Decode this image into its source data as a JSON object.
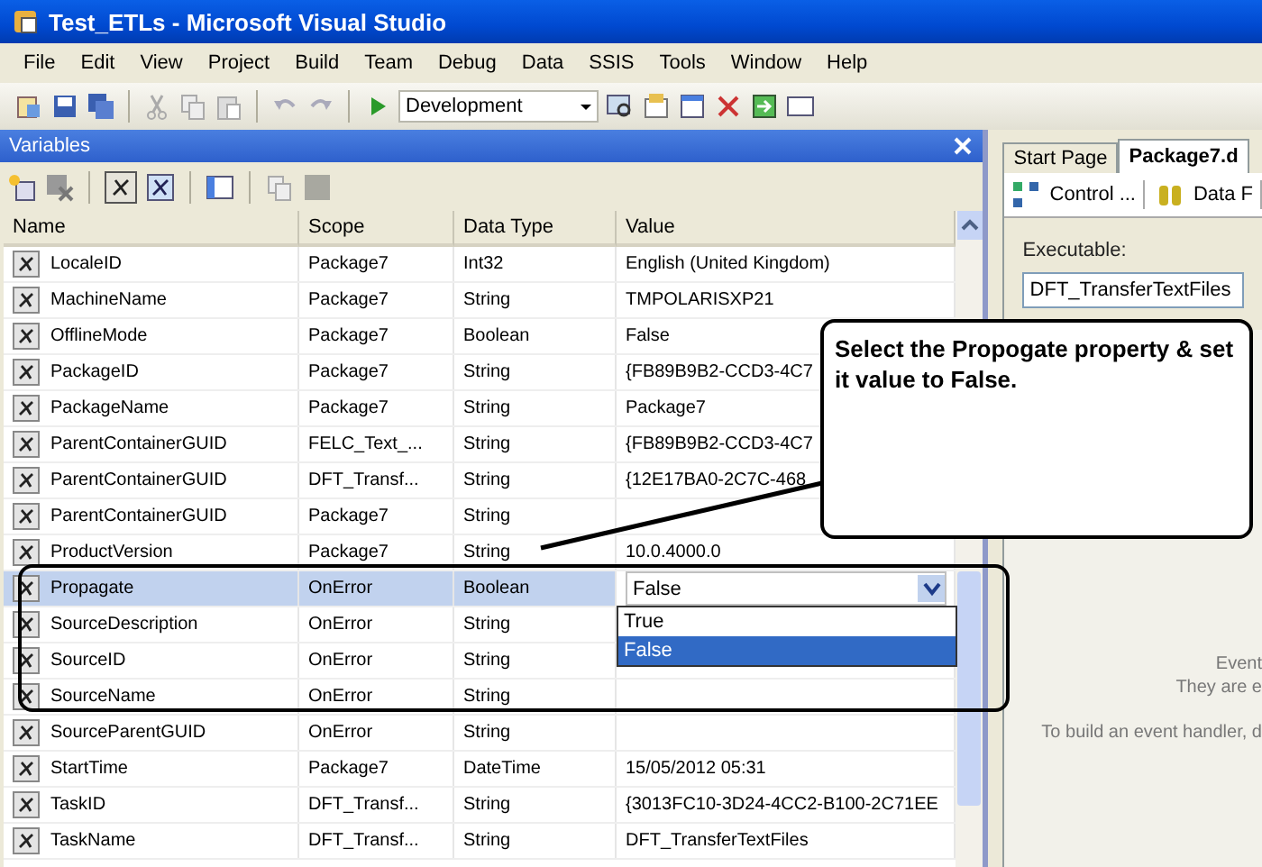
{
  "window": {
    "title": "Test_ETLs - Microsoft Visual Studio"
  },
  "menu": [
    "File",
    "Edit",
    "View",
    "Project",
    "Build",
    "Team",
    "Debug",
    "Data",
    "SSIS",
    "Tools",
    "Window",
    "Help"
  ],
  "toolbar": {
    "configuration": "Development"
  },
  "variables": {
    "title": "Variables",
    "columns": [
      "Name",
      "Scope",
      "Data Type",
      "Value"
    ],
    "rows": [
      {
        "name": "LocaleID",
        "scope": "Package7",
        "type": "Int32",
        "value": "English (United Kingdom)",
        "selected": false
      },
      {
        "name": "MachineName",
        "scope": "Package7",
        "type": "String",
        "value": "TMPOLARISXP21",
        "selected": false
      },
      {
        "name": "OfflineMode",
        "scope": "Package7",
        "type": "Boolean",
        "value": "False",
        "selected": false
      },
      {
        "name": "PackageID",
        "scope": "Package7",
        "type": "String",
        "value": "{FB89B9B2-CCD3-4C7",
        "selected": false
      },
      {
        "name": "PackageName",
        "scope": "Package7",
        "type": "String",
        "value": "Package7",
        "selected": false
      },
      {
        "name": "ParentContainerGUID",
        "scope": "FELC_Text_...",
        "type": "String",
        "value": "{FB89B9B2-CCD3-4C7",
        "selected": false
      },
      {
        "name": "ParentContainerGUID",
        "scope": "DFT_Transf...",
        "type": "String",
        "value": "{12E17BA0-2C7C-468",
        "selected": false
      },
      {
        "name": "ParentContainerGUID",
        "scope": "Package7",
        "type": "String",
        "selected": false
      },
      {
        "name": "ProductVersion",
        "scope": "Package7",
        "type": "String",
        "value": "10.0.4000.0",
        "selected": false
      },
      {
        "name": "Propagate",
        "scope": "OnError",
        "type": "Boolean",
        "value": "False",
        "selected": true
      },
      {
        "name": "SourceDescription",
        "scope": "OnError",
        "type": "String",
        "selected": false
      },
      {
        "name": "SourceID",
        "scope": "OnError",
        "type": "String",
        "selected": false
      },
      {
        "name": "SourceName",
        "scope": "OnError",
        "type": "String",
        "selected": false
      },
      {
        "name": "SourceParentGUID",
        "scope": "OnError",
        "type": "String",
        "selected": false
      },
      {
        "name": "StartTime",
        "scope": "Package7",
        "type": "DateTime",
        "value": "15/05/2012 05:31",
        "selected": false
      },
      {
        "name": "TaskID",
        "scope": "DFT_Transf...",
        "type": "String",
        "value": "{3013FC10-3D24-4CC2-B100-2C71EE",
        "selected": false
      },
      {
        "name": "TaskName",
        "scope": "DFT_Transf...",
        "type": "String",
        "value": "DFT_TransferTextFiles",
        "selected": false
      }
    ],
    "dropdown_options": [
      {
        "label": "True",
        "selected": false
      },
      {
        "label": "False",
        "selected": true
      }
    ]
  },
  "callout": {
    "text": "Select the Propogate property & set it value to False."
  },
  "designer": {
    "tabs": [
      {
        "label": "Start Page",
        "selected": false
      },
      {
        "label": "Package7.d",
        "selected": true
      }
    ],
    "subtabs": [
      "Control ...",
      "Data F"
    ],
    "executable_label": "Executable:",
    "executable_value": "DFT_TransferTextFiles",
    "messages": [
      "Event",
      "They are e",
      "To build an event handler, d"
    ]
  }
}
